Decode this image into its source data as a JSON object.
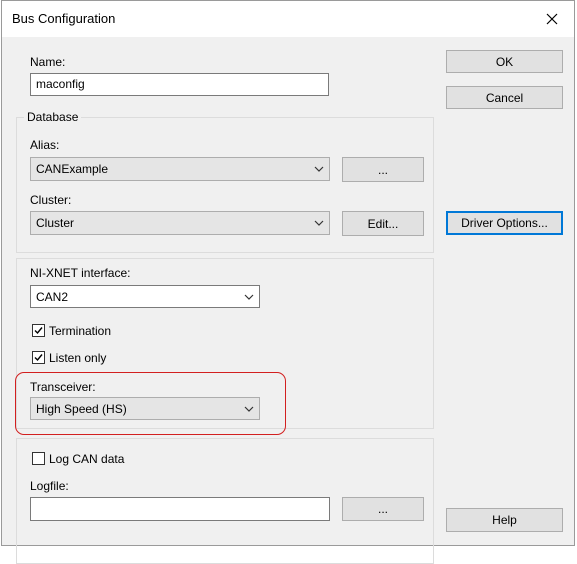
{
  "window": {
    "title": "Bus Configuration"
  },
  "name": {
    "label": "Name:",
    "value": "maconfig"
  },
  "database": {
    "group_title": "Database",
    "alias_label": "Alias:",
    "alias_value": "CANExample",
    "alias_browse": "...",
    "cluster_label": "Cluster:",
    "cluster_value": "Cluster",
    "cluster_edit": "Edit..."
  },
  "interface": {
    "label": "NI-XNET interface:",
    "value": "CAN2",
    "termination_label": "Termination",
    "termination_checked": true,
    "listen_only_label": "Listen only",
    "listen_only_checked": true,
    "transceiver_label": "Transceiver:",
    "transceiver_value": "High Speed (HS)"
  },
  "logging": {
    "log_label": "Log CAN data",
    "log_checked": false,
    "logfile_label": "Logfile:",
    "logfile_value": "",
    "logfile_browse": "..."
  },
  "buttons": {
    "ok": "OK",
    "cancel": "Cancel",
    "driver_options": "Driver Options...",
    "help": "Help"
  },
  "colors": {
    "highlight": "#d21f1f",
    "focus": "#0078d7"
  }
}
